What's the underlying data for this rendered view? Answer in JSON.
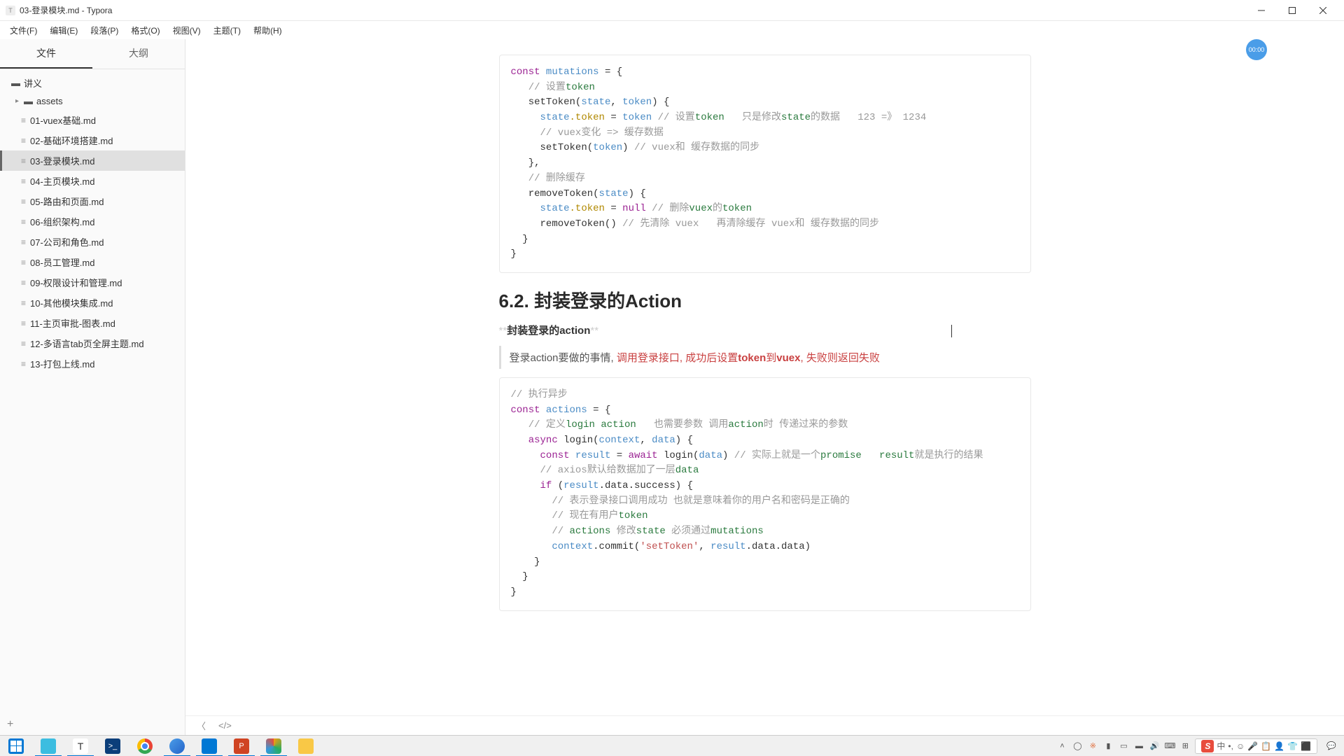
{
  "window": {
    "title": "03-登录模块.md - Typora"
  },
  "menu": [
    "文件(F)",
    "编辑(E)",
    "段落(P)",
    "格式(O)",
    "视图(V)",
    "主题(T)",
    "帮助(H)"
  ],
  "sidebar": {
    "tabs": {
      "files": "文件",
      "outline": "大纲"
    },
    "root": "讲义",
    "sub": "assets",
    "items": [
      "01-vuex基础.md",
      "02-基础环境搭建.md",
      "03-登录模块.md",
      "04-主页模块.md",
      "05-路由和页面.md",
      "06-组织架构.md",
      "07-公司和角色.md",
      "08-员工管理.md",
      "09-权限设计和管理.md",
      "10-其他模块集成.md",
      "11-主页审批-图表.md",
      "12-多语言tab页全屏主题.md",
      "13-打包上线.md"
    ],
    "active_index": 2
  },
  "doc": {
    "code1": {
      "l1": {
        "kw": "const",
        "v": "mutations",
        "rest": " = {"
      },
      "l2": {
        "cm": "// 设置",
        "cmv": "token"
      },
      "l3": {
        "fn": "setToken(",
        "a1": "state",
        "c": ", ",
        "a2": "token",
        "end": ") {"
      },
      "l4": {
        "o": "state",
        "p": ".token",
        "eq": " = ",
        "v": "token",
        "cm1": " // 设置",
        "cmv1": "token",
        "cm2": "   只是修改",
        "cmv2": "state",
        "cm3": "的数据   123 =》 1234"
      },
      "l5": {
        "cm": "// vuex变化 => 缓存数据"
      },
      "l6": {
        "fn": "setToken(",
        "a": "token",
        "end": ")",
        "cm1": " // vuex和 缓存数据的同步"
      },
      "l7": "},",
      "l8": {
        "cm": "// 删除缓存"
      },
      "l9": {
        "fn": "removeToken(",
        "a": "state",
        "end": ") {"
      },
      "l10": {
        "o": "state",
        "p": ".token",
        "eq": " = ",
        "kw": "null",
        "cm1": " // 删除",
        "cmv1": "vuex",
        "cm2": "的",
        "cmv2": "token"
      },
      "l11": {
        "fn": "removeToken()",
        "cm1": " // 先清除 vuex   再清除缓存 vuex和 缓存数据的同步"
      },
      "l12": "  }",
      "l13": "}"
    },
    "h2": "6.2. 封装登录的Action",
    "boldline": {
      "stars": "**",
      "text": "封装登录的action"
    },
    "quote": {
      "pre": "登录action要做的事情, ",
      "r1": "调用登录接口",
      "c1": ", ",
      "r2": "成功后设置",
      "rb1": "token",
      "r3": "到",
      "rb2": "vuex",
      "c2": ", ",
      "r4": "失败则返回失败"
    },
    "code2": {
      "l1": {
        "cm": "// 执行异步"
      },
      "l2": {
        "kw": "const",
        "v": "actions",
        "rest": " = {"
      },
      "l3": {
        "cm1": "// 定义",
        "cmv1": "login action",
        "cm2": "   也需要参数 调用",
        "cmv2": "action",
        "cm3": "时 传递过来的参数"
      },
      "l4": {
        "kw": "async",
        "fn": " login(",
        "a1": "context",
        "c": ", ",
        "a2": "data",
        "end": ") {"
      },
      "l5": {
        "kw": "const",
        "v": " result",
        "eq": " = ",
        "kw2": "await",
        "fn": " login(",
        "a": "data",
        "end": ")",
        "cm1": " // 实际上就是一个",
        "cmv1": "promise",
        "cm2": "   ",
        "cmv2": "result",
        "cm3": "就是执行的结果"
      },
      "l6": {
        "cm1": "// axios默认给数据加了一层",
        "cmv1": "data"
      },
      "l7": {
        "kw": "if",
        "p1": " (",
        "v": "result",
        "p2": ".data.success) {"
      },
      "l8": {
        "cm": "// 表示登录接口调用成功 也就是意味着你的用户名和密码是正确的"
      },
      "l9": {
        "cm1": "// 现在有用户",
        "cmv1": "token"
      },
      "l10": {
        "cm1": "// ",
        "cmv1": "actions",
        "cm2": " 修改",
        "cmv2": "state",
        "cm3": " 必须通过",
        "cmv3": "mutations"
      },
      "l11": {
        "o": "context",
        "m": ".commit(",
        "s": "'setToken'",
        "c": ", ",
        "v": "result",
        "rest": ".data.data)"
      },
      "l12": "    }",
      "l13": "  }",
      "l14": "}"
    }
  },
  "badge": "00:00",
  "ime": {
    "s": "S",
    "items": [
      "中",
      "•,",
      "☺",
      "🎤",
      "📋",
      "👤",
      "👕",
      "⬛"
    ]
  }
}
